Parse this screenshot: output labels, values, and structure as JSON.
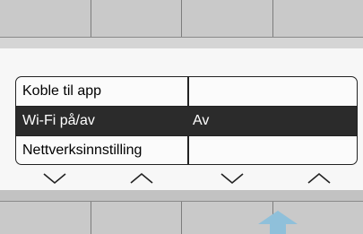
{
  "menu": {
    "items": [
      {
        "label": "Koble til app",
        "value": ""
      },
      {
        "label": "Wi-Fi på/av",
        "value": "Av"
      },
      {
        "label": "Nettverksinnstilling",
        "value": ""
      }
    ],
    "selected_index": 1
  },
  "indicators": [
    {
      "icon": "chevron-down-icon"
    },
    {
      "icon": "chevron-up-icon"
    },
    {
      "icon": "chevron-down-icon"
    },
    {
      "icon": "chevron-up-icon"
    }
  ],
  "pointer": {
    "icon": "arrow-up-icon",
    "color": "#8fc0da"
  },
  "colors": {
    "softkey": "#c9c9c9",
    "selected_row": "#2b2b2b",
    "background": "#f7f7f7"
  }
}
